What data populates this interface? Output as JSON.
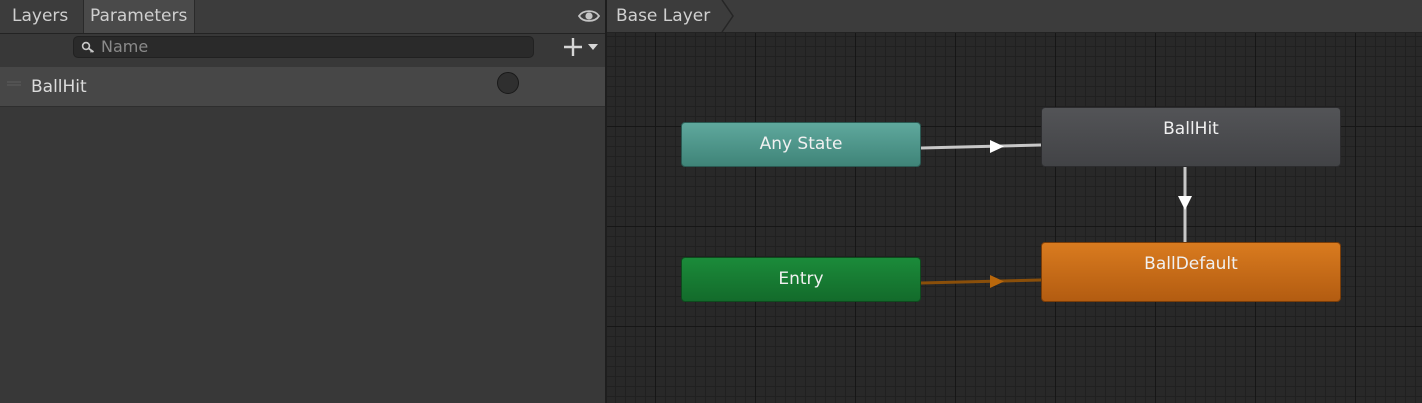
{
  "left_panel": {
    "tabs": [
      {
        "label": "Layers",
        "active": false
      },
      {
        "label": "Parameters",
        "active": true
      }
    ],
    "visibility_icon": "eye-icon",
    "search": {
      "placeholder": "Name",
      "value": "",
      "icon": "search-icon"
    },
    "add_button_icon": "plus-dropdown-icon",
    "parameters": [
      {
        "name": "BallHit",
        "type": "trigger",
        "handle_icon": "drag-handle-icon"
      }
    ]
  },
  "graph": {
    "breadcrumb": {
      "label": "Base Layer"
    },
    "states": {
      "any_state": {
        "label": "Any State",
        "color": "#4f978b"
      },
      "ballhit": {
        "label": "BallHit",
        "color": "#4b4c4f"
      },
      "entry": {
        "label": "Entry",
        "color": "#177b33"
      },
      "balldefault": {
        "label": "BallDefault",
        "color": "#c86b18"
      }
    },
    "transitions": [
      {
        "from": "Any State",
        "to": "BallHit",
        "color": "#c8c8c8"
      },
      {
        "from": "BallHit",
        "to": "BallDefault",
        "color": "#c8c8c8"
      },
      {
        "from": "Entry",
        "to": "BallDefault",
        "color": "#a05a0a"
      }
    ]
  }
}
